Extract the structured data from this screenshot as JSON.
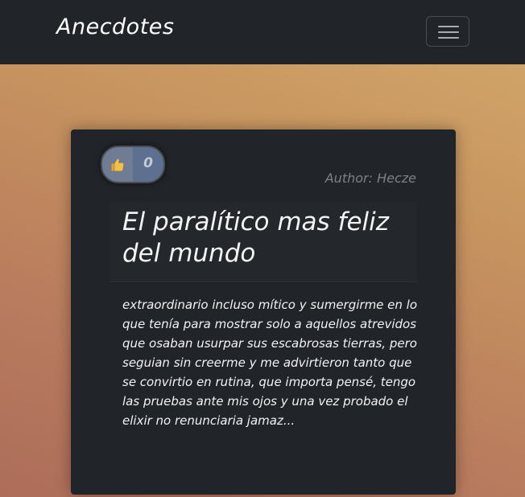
{
  "navbar": {
    "brand": "Anecdotes",
    "toggler_icon": "hamburger-icon"
  },
  "card": {
    "like_icon": "thumbs-up-icon",
    "like_count": "0",
    "author": "Author: Hecze",
    "title": "El paralítico mas feliz del mundo",
    "body": "extraordinario incluso mítico y sumergirme en lo que tenía para mostrar solo a aquellos atrevidos que osaban usurpar sus escabrosas tierras, pero seguian sin creerme y me advirtieron tanto que se convirtio en rutina, que importa pensé, tengo las pruebas ante mis ojos y una vez probado el elixir no renunciaria jamaz..."
  },
  "colors": {
    "navbar_bg": "#212529",
    "card_bg": "#212529",
    "like_pill": "#5e7090",
    "background_gradient": [
      "#d3aa6c",
      "#ad6d5a"
    ]
  }
}
